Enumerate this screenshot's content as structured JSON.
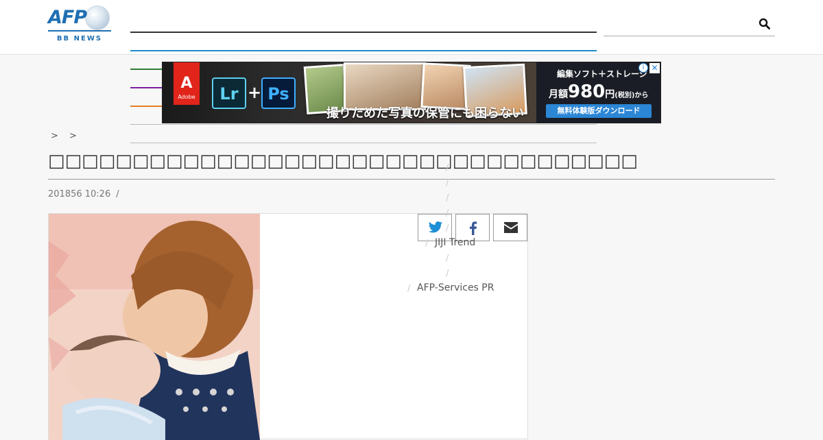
{
  "header": {
    "logo_text": "AFP",
    "logo_sub": "BB NEWS",
    "search": {
      "placeholder": "",
      "value": ""
    }
  },
  "ad": {
    "adobe_label": "Adobe",
    "app1": "Lr",
    "app2": "Ps",
    "plus": "+",
    "tagline": "撮りためた写真の保管にも困らない",
    "right_line1": "編集ソフト＋ストレージ",
    "right_prefix": "月額",
    "right_price": "980",
    "right_yen": "円",
    "right_tax": "(税別)から",
    "cta": "無料体験版ダウンロード",
    "info": "i",
    "close": "✕"
  },
  "breadcrumb": "> >",
  "article": {
    "title": "□□□□□□□□□□□□□□□□□□□□□□□□□□□□□□□□□□□",
    "date": "201856 10:26",
    "date_sep": "/"
  },
  "sidebar": {
    "links": [
      {
        "label": "JIJI Trend"
      },
      {
        "label": "AFP-Services PR"
      }
    ],
    "slash": "/"
  },
  "share": {
    "twitter": "twitter-icon",
    "facebook": "facebook-icon",
    "mail": "mail-icon"
  },
  "colors": {
    "brand": "#1f6fb2",
    "lines": [
      "#333333",
      "#1f8ac9",
      "#2e7d32",
      "#7b1fa2",
      "#e67e22",
      "#bbbbbb",
      "#bbbbbb"
    ]
  }
}
